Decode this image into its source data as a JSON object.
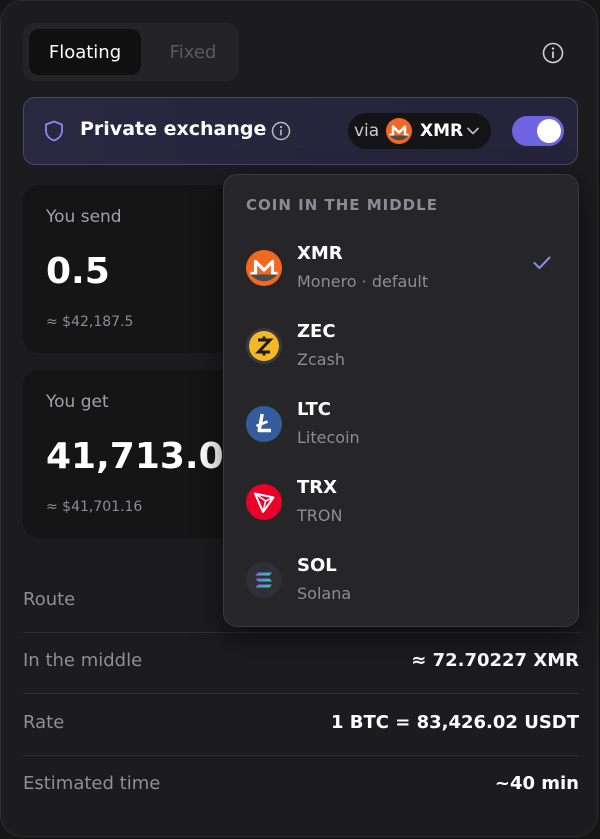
{
  "mode_toggle": {
    "floating": "Floating",
    "fixed": "Fixed"
  },
  "private": {
    "title": "Private exchange",
    "via_label": "via",
    "via_coin": "XMR",
    "enabled": true
  },
  "send": {
    "label": "You send",
    "amount": "0.5",
    "usd": "≈ $42,187.5"
  },
  "get": {
    "label": "You get",
    "amount": "41,713.01",
    "usd": "≈ $41,701.16"
  },
  "details": [
    {
      "label": "Route",
      "value": ""
    },
    {
      "label": "In the middle",
      "value": "≈ 72.70227 XMR"
    },
    {
      "label": "Rate",
      "value": "1 BTC = 83,426.02 USDT"
    },
    {
      "label": "Estimated time",
      "value": "~40 min"
    }
  ],
  "dropdown": {
    "header": "COIN IN THE MIDDLE",
    "coins": [
      {
        "symbol": "XMR",
        "name": "Monero · default",
        "selected": true,
        "icon": "monero-icon",
        "color": "#f26822"
      },
      {
        "symbol": "ZEC",
        "name": "Zcash",
        "selected": false,
        "icon": "zcash-icon",
        "color": "#f4b728"
      },
      {
        "symbol": "LTC",
        "name": "Litecoin",
        "selected": false,
        "icon": "litecoin-icon",
        "color": "#345d9d"
      },
      {
        "symbol": "TRX",
        "name": "TRON",
        "selected": false,
        "icon": "tron-icon",
        "color": "#eb0029"
      },
      {
        "symbol": "SOL",
        "name": "Solana",
        "selected": false,
        "icon": "solana-icon",
        "color": "#2f2f35"
      }
    ]
  },
  "colors": {
    "accent": "#6f63e0",
    "background": "#1c1c1e"
  }
}
